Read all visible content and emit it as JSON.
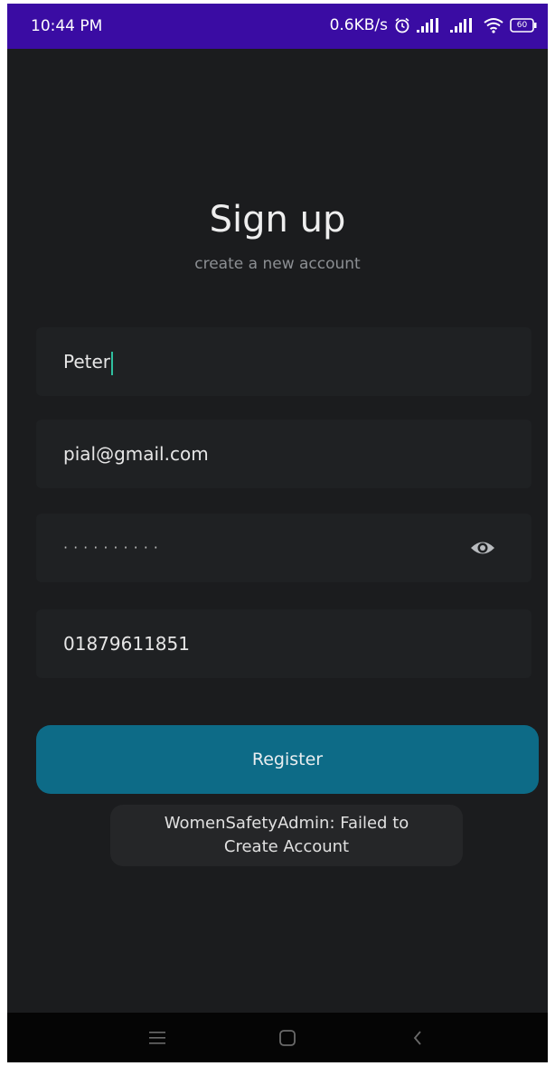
{
  "status_bar": {
    "time": "10:44 PM",
    "network_speed": "0.6KB/s",
    "alarm_icon": "alarm-clock-icon",
    "signal_icons": [
      "signal-bars-icon",
      "signal-bars-icon"
    ],
    "wifi_icon": "wifi-icon",
    "battery_level": "60",
    "color": "#3a0ca3"
  },
  "header": {
    "title": "Sign up",
    "subtitle": "create a new account"
  },
  "form": {
    "name_value": "Peter",
    "email_value": "pial@gmail.com",
    "password_value": "··········",
    "password_toggle_icon": "eye-icon",
    "phone_value": "01879611851"
  },
  "actions": {
    "register_label": "Register",
    "register_color": "#0d6b87"
  },
  "toast": {
    "message": "WomenSafetyAdmin: Failed to Create Account"
  },
  "nav_bar": {
    "icons": [
      "menu-icon",
      "home-square-icon",
      "back-chevron-icon"
    ]
  }
}
